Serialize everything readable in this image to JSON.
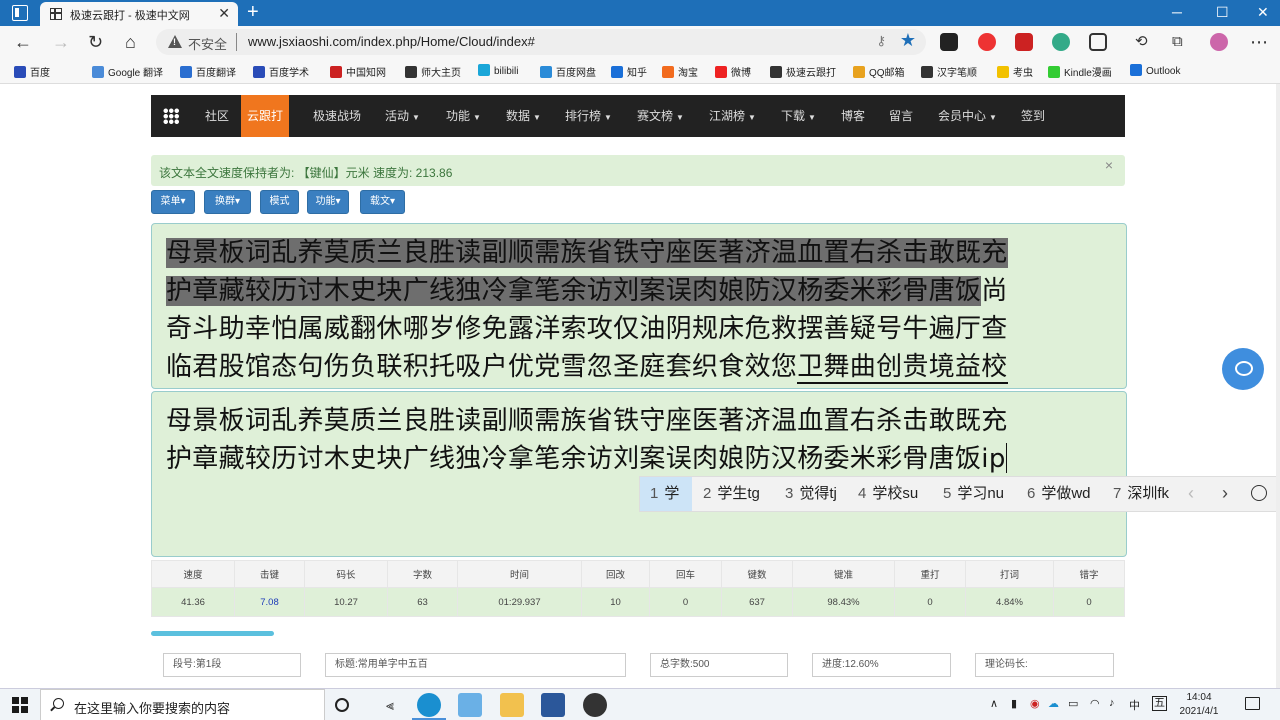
{
  "browser": {
    "tab_title": "极速云跟打 - 极速中文网",
    "tab_close": "✕",
    "new_tab": "+",
    "insecure_label": "不安全",
    "url": "www.jsxiaoshi.com/index.php/Home/Cloud/index#",
    "bookmarks": [
      "百度",
      "Google 翻译",
      "百度翻译",
      "百度学术",
      "中国知网",
      "师大主页",
      "bilibili",
      "百度网盘",
      "知乎",
      "淘宝",
      "微博",
      "极速云跟打",
      "QQ邮箱",
      "汉字笔顺",
      "考虫",
      "Kindle漫画",
      "Outlook"
    ],
    "bookmark_prefixes": [
      "",
      "",
      "",
      "",
      "",
      "",
      "",
      "",
      "",
      "",
      "",
      "",
      "",
      "顺",
      "",
      "",
      ""
    ]
  },
  "nav": {
    "items": [
      {
        "label": "社区",
        "caret": ""
      },
      {
        "label": "云跟打",
        "caret": ""
      },
      {
        "label": "极速战场",
        "caret": ""
      },
      {
        "label": "活动",
        "caret": "▼"
      },
      {
        "label": "功能",
        "caret": "▼"
      },
      {
        "label": "数据",
        "caret": "▼"
      },
      {
        "label": "排行榜",
        "caret": "▼"
      },
      {
        "label": "赛文榜",
        "caret": "▼"
      },
      {
        "label": "江湖榜",
        "caret": "▼"
      },
      {
        "label": "下载",
        "caret": "▼"
      },
      {
        "label": "博客",
        "caret": ""
      },
      {
        "label": "留言",
        "caret": ""
      },
      {
        "label": "会员中心",
        "caret": "▼"
      },
      {
        "label": "签到",
        "caret": ""
      }
    ]
  },
  "alert": {
    "text": "该文本全文速度保持者为: 【键仙】元米 速度为: 213.86",
    "close": "×"
  },
  "toolbar": {
    "buttons": [
      "菜单▾",
      "换群▾",
      "模式",
      "功能▾",
      "载文▾"
    ]
  },
  "source_text": {
    "line1": "母景板词乱养莫质兰良胜读副顺需族省铁守座医著济温血置右杀击敢既充",
    "line2_hl": "护章藏较历讨木史块广线独冷拿笔余访刘案误肉娘防汉杨委米彩骨唐饭",
    "line2_rest": "尚",
    "line3": "奇斗助幸怕属威翻休哪岁修免露洋索攻仅油阴规床危救摆善疑号牛遍厅查",
    "line4_a": "临君股馆态句伤负联积托吸户优党雪忽圣庭套织食效您",
    "line4_ul": "卫舞曲创贵境益校"
  },
  "typed_text": {
    "line1": "母景板词乱养莫质兰良胜读副顺需族省铁守座医著济温血置右杀击敢既充",
    "line2": "护章藏较历讨木史块广线独冷拿笔余访刘案误肉娘防汉杨委米彩骨唐饭ip"
  },
  "ime": {
    "candidates": [
      {
        "num": "1",
        "text": "学"
      },
      {
        "num": "2",
        "text": "学生tg"
      },
      {
        "num": "3",
        "text": "觉得tj"
      },
      {
        "num": "4",
        "text": "学校su"
      },
      {
        "num": "5",
        "text": "学习nu"
      },
      {
        "num": "6",
        "text": "学做wd"
      },
      {
        "num": "7",
        "text": "深圳fk"
      }
    ],
    "prev": "‹",
    "next": "›"
  },
  "stats": {
    "headers": [
      "速度",
      "击键",
      "码长",
      "字数",
      "时间",
      "回改",
      "回车",
      "键数",
      "键准",
      "重打",
      "打词",
      "错字"
    ],
    "values": [
      "41.36",
      "7.08",
      "10.27",
      "63",
      "01:29.937",
      "10",
      "0",
      "637",
      "98.43%",
      "0",
      "4.84%",
      "0"
    ]
  },
  "progress": {
    "fraction": 0.126
  },
  "info": {
    "segment": "段号:第1段",
    "title": "标题:常用单字中五百",
    "total": "总字数:500",
    "progress": "进度:12.60%",
    "theory": "理论码长:"
  },
  "taskbar": {
    "search_placeholder": "在这里输入你要搜索的内容",
    "ime_lang": "中",
    "ime_mode": "五",
    "time": "14:04",
    "date": "2021/4/1"
  },
  "colors": {
    "accent": "#f0761e",
    "nav_bg": "#222222",
    "panel_bg": "#dff0d8",
    "button": "#3a7fc0",
    "browser_blue": "#1e6fb8"
  }
}
